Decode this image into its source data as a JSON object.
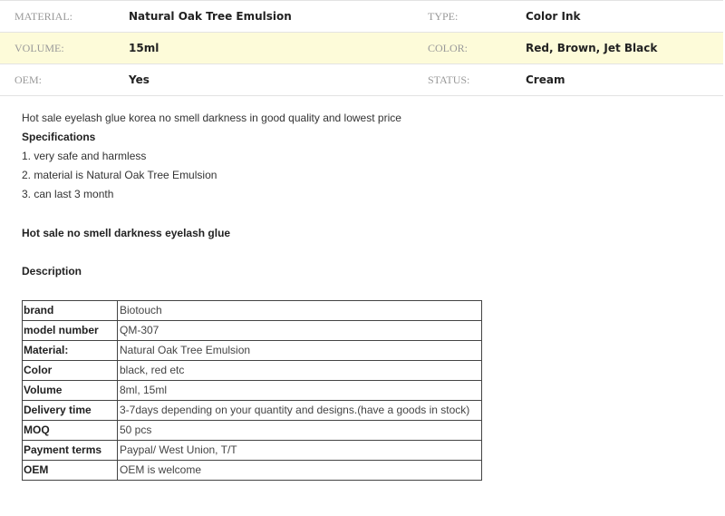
{
  "specs": [
    {
      "label1": "MATERIAL:",
      "value1": "Natural Oak Tree Emulsion",
      "label2": "TYPE:",
      "value2": "Color Ink"
    },
    {
      "label1": "VOLUME:",
      "value1": "15ml",
      "label2": "COLOR:",
      "value2": "Red, Brown, Jet Black"
    },
    {
      "label1": "OEM:",
      "value1": "Yes",
      "label2": "STATUS:",
      "value2": "Cream"
    }
  ],
  "description": {
    "intro": "Hot sale eyelash glue korea no smell darkness in good quality and lowest price",
    "specs_heading": "Specifications",
    "points": [
      "1. very safe and harmless",
      "2. material is Natural Oak Tree Emulsion",
      "3. can last 3 month"
    ],
    "product_heading": "Hot sale no smell darkness eyelash glue",
    "description_heading": "Description"
  },
  "details": [
    {
      "key": "brand",
      "value": "Biotouch"
    },
    {
      "key": "model number",
      "value": "QM-307"
    },
    {
      "key": "Material:",
      "value": "Natural Oak Tree Emulsion"
    },
    {
      "key": "Color",
      "value": "black, red etc"
    },
    {
      "key": "Volume",
      "value": "8ml, 15ml"
    },
    {
      "key": "Delivery time",
      "value": "3-7days depending on your quantity and designs.(have a goods in stock)"
    },
    {
      "key": "MOQ",
      "value": "50 pcs"
    },
    {
      "key": "Payment terms",
      "value": "Paypal/ West Union, T/T"
    },
    {
      "key": "OEM",
      "value": "OEM is welcome"
    }
  ]
}
